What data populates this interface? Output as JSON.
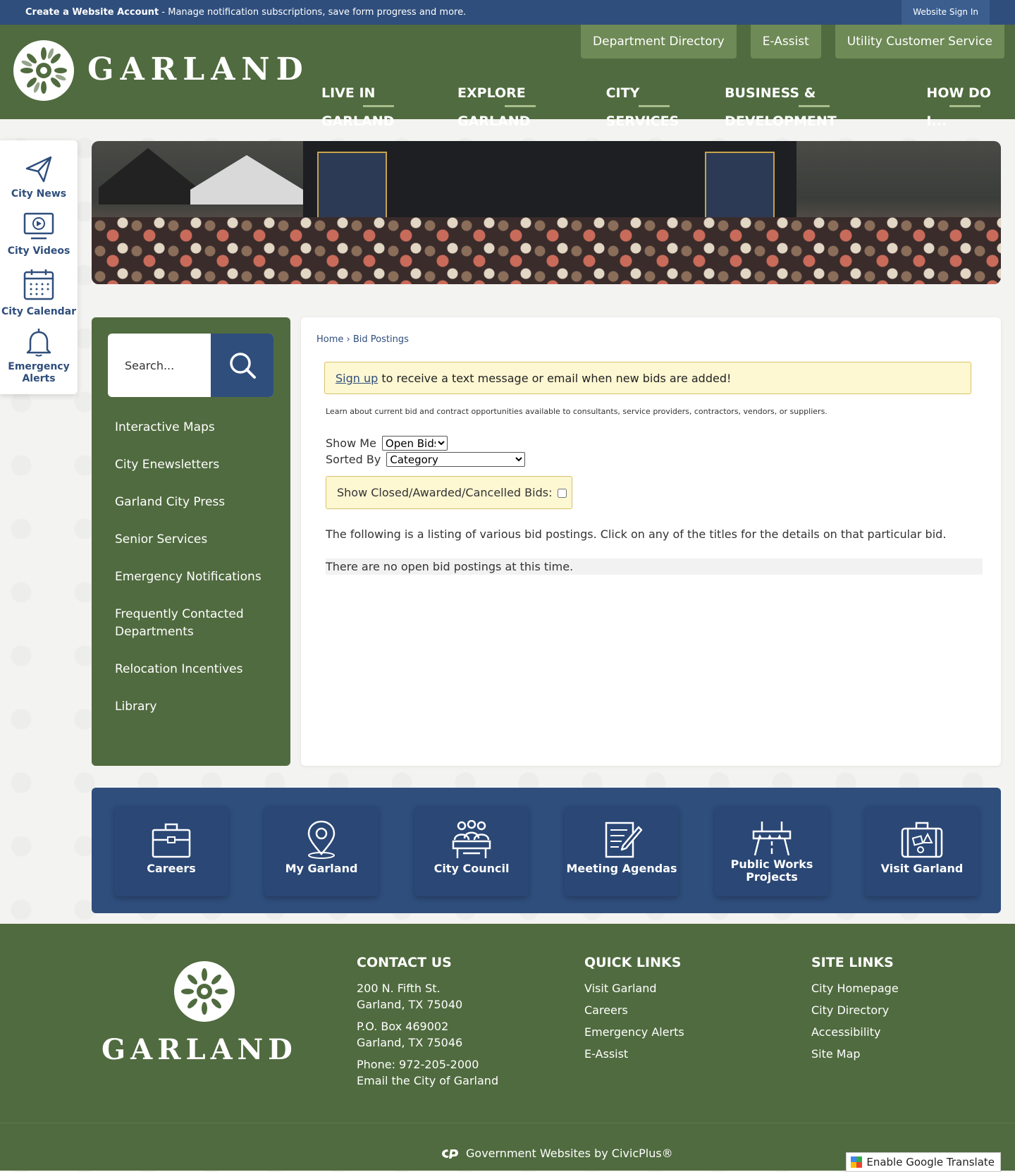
{
  "topbar": {
    "create_account": "Create a Website Account",
    "create_account_desc": " - Manage notification subscriptions, save form progress and more.",
    "sign_in": "Website Sign In"
  },
  "header": {
    "logo_text": "GARLAND",
    "util_links": [
      "Department Directory",
      "E-Assist",
      "Utility Customer Service"
    ],
    "nav": [
      "LIVE IN GARLAND",
      "EXPLORE GARLAND",
      "CITY SERVICES",
      "BUSINESS & DEVELOPMENT",
      "HOW DO I..."
    ]
  },
  "rail": {
    "items": [
      {
        "label": "City News",
        "icon": "paper-plane-icon"
      },
      {
        "label": "City Videos",
        "icon": "video-icon"
      },
      {
        "label": "City Calendar",
        "icon": "calendar-icon"
      },
      {
        "label": "Emergency Alerts",
        "icon": "bell-icon"
      }
    ]
  },
  "search": {
    "placeholder": "Search..."
  },
  "sidebar": {
    "links": [
      "Interactive Maps",
      "City Enewsletters",
      "Garland City Press",
      "Senior Services",
      "Emergency Notifications",
      "Frequently Contacted Departments",
      "Relocation Incentives",
      "Library"
    ]
  },
  "main": {
    "breadcrumb_home": "Home",
    "breadcrumb_sep": " › ",
    "breadcrumb_current": "Bid Postings",
    "notice_link": "Sign up",
    "notice_text": " to receive a text message or email when new bids are added!",
    "intro": "Learn about current bid and contract opportunities available to consultants, service providers, contractors, vendors, or suppliers.",
    "show_me_label": "Show Me",
    "show_me_value": "Open Bids",
    "sorted_by_label": "Sorted By",
    "sorted_by_value": "Category",
    "closed_label": "Show Closed/Awarded/Cancelled Bids:",
    "listing_text": "The following is a listing of various bid postings. Click on any of the titles for the details on that particular bid.",
    "no_bids": "There are no open bid postings at this time."
  },
  "tiles": [
    {
      "label": "Careers",
      "icon": "briefcase-icon"
    },
    {
      "label": "My Garland",
      "icon": "map-pin-icon"
    },
    {
      "label": "City Council",
      "icon": "council-icon"
    },
    {
      "label": "Meeting Agendas",
      "icon": "agenda-icon"
    },
    {
      "label": "Public Works Projects",
      "icon": "road-icon"
    },
    {
      "label": "Visit Garland",
      "icon": "suitcase-icon"
    }
  ],
  "footer": {
    "logo_text": "GARLAND",
    "contact": {
      "heading": "CONTACT US",
      "address1": "200 N. Fifth St.",
      "address2": "Garland, TX 75040",
      "po1": "P.O. Box 469002",
      "po2": "Garland, TX 75046",
      "phone": "Phone: 972-205-2000",
      "email": "Email the City of Garland"
    },
    "quick_links": {
      "heading": "QUICK LINKS",
      "items": [
        "Visit Garland",
        "Careers",
        "Emergency Alerts",
        "E-Assist"
      ]
    },
    "site_links": {
      "heading": "SITE LINKS",
      "items": [
        "City Homepage",
        "City Directory",
        "Accessibility",
        "Site Map"
      ]
    },
    "credit": "Government Websites by CivicPlus®",
    "translate": "Enable Google Translate"
  },
  "colors": {
    "navy": "#2f4e7c",
    "green": "#506b3f",
    "notice": "#fdf7d2"
  }
}
